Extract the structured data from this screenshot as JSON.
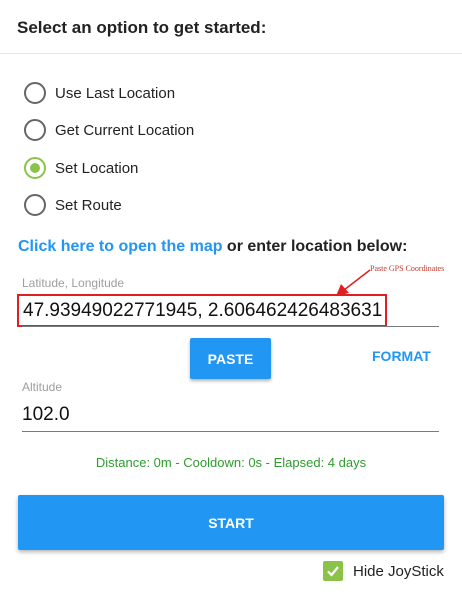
{
  "header": {
    "title": "Select an option to get started:"
  },
  "options": [
    {
      "label": "Use Last Location",
      "checked": false
    },
    {
      "label": "Get Current Location",
      "checked": false
    },
    {
      "label": "Set Location",
      "checked": true
    },
    {
      "label": "Set Route",
      "checked": false
    }
  ],
  "map_prompt": {
    "link_text": "Click here to open the map",
    "rest_text": " or enter location below:"
  },
  "latlng": {
    "label": "Latitude, Longitude",
    "value": "47.93949022771945, 2.606462426483631"
  },
  "annotation": {
    "text": "Paste GPS Coordinates"
  },
  "buttons": {
    "paste": "PASTE",
    "format": "FORMAT",
    "start": "START"
  },
  "altitude": {
    "label": "Altitude",
    "value": "102.0"
  },
  "status": {
    "text": "Distance: 0m - Cooldown: 0s - Elapsed: 4 days"
  },
  "joystick": {
    "label": "Hide JoyStick",
    "checked": true
  },
  "colors": {
    "accent_blue": "#2196f3",
    "radio_green": "#8bc34a",
    "status_green": "#2e9c2e",
    "annotation_red": "#e02020"
  }
}
